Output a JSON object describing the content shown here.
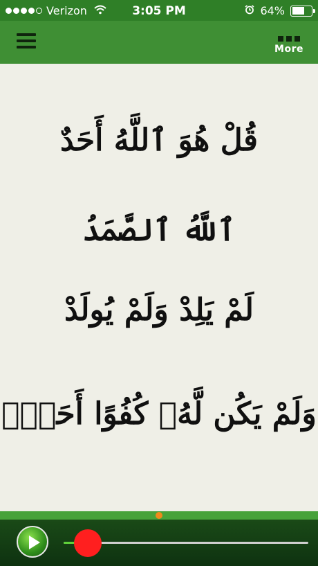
{
  "status_bar": {
    "carrier": "Verizon",
    "time": "3:05 PM",
    "battery_percent": "64%",
    "battery_level": 0.64,
    "signal_bars_filled": 4,
    "signal_bars_total": 5,
    "icons": [
      "signal-icon",
      "wifi-icon",
      "alarm-icon",
      "battery-icon"
    ]
  },
  "nav": {
    "menu_icon": "hamburger-menu-icon",
    "more_label": "More",
    "more_icon": "grid-icon"
  },
  "verses": [
    "قُلْ هُوَ ٱللَّهُ أَحَدٌ",
    "ٱللَّهُ ٱلصَّمَدُ",
    "لَمْ يَلِدْ وَلَمْ يُولَدْ",
    "وَلَمْ يَكُن لَّهُۥ كُفُوًا أَحَدٌۢ"
  ],
  "player": {
    "play_icon": "play-icon",
    "progress": 0.1,
    "colors": {
      "thumb": "#ff1f1f",
      "progress_fill": "#5fd13a",
      "marker": "#f08a1c"
    }
  },
  "theme": {
    "nav_background": "#3f8f34",
    "content_background": "#efefe7"
  }
}
